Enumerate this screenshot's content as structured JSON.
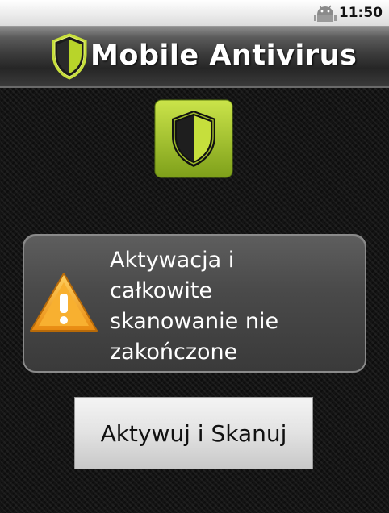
{
  "status_bar": {
    "time": "11:50",
    "icon": "android-debug-icon"
  },
  "title_bar": {
    "icon": "shield-icon",
    "title": "Mobile Antivirus"
  },
  "main": {
    "logo_icon": "app-shield-logo-icon",
    "warning": {
      "icon": "warning-triangle-icon",
      "lines": [
        "Aktywacja i",
        "całkowite",
        "skanowanie nie",
        "zakończone"
      ]
    },
    "action_button": {
      "label": "Aktywuj i Skanuj"
    }
  },
  "colors": {
    "accent_green": "#b8d42a",
    "warning_orange": "#f0a020"
  }
}
